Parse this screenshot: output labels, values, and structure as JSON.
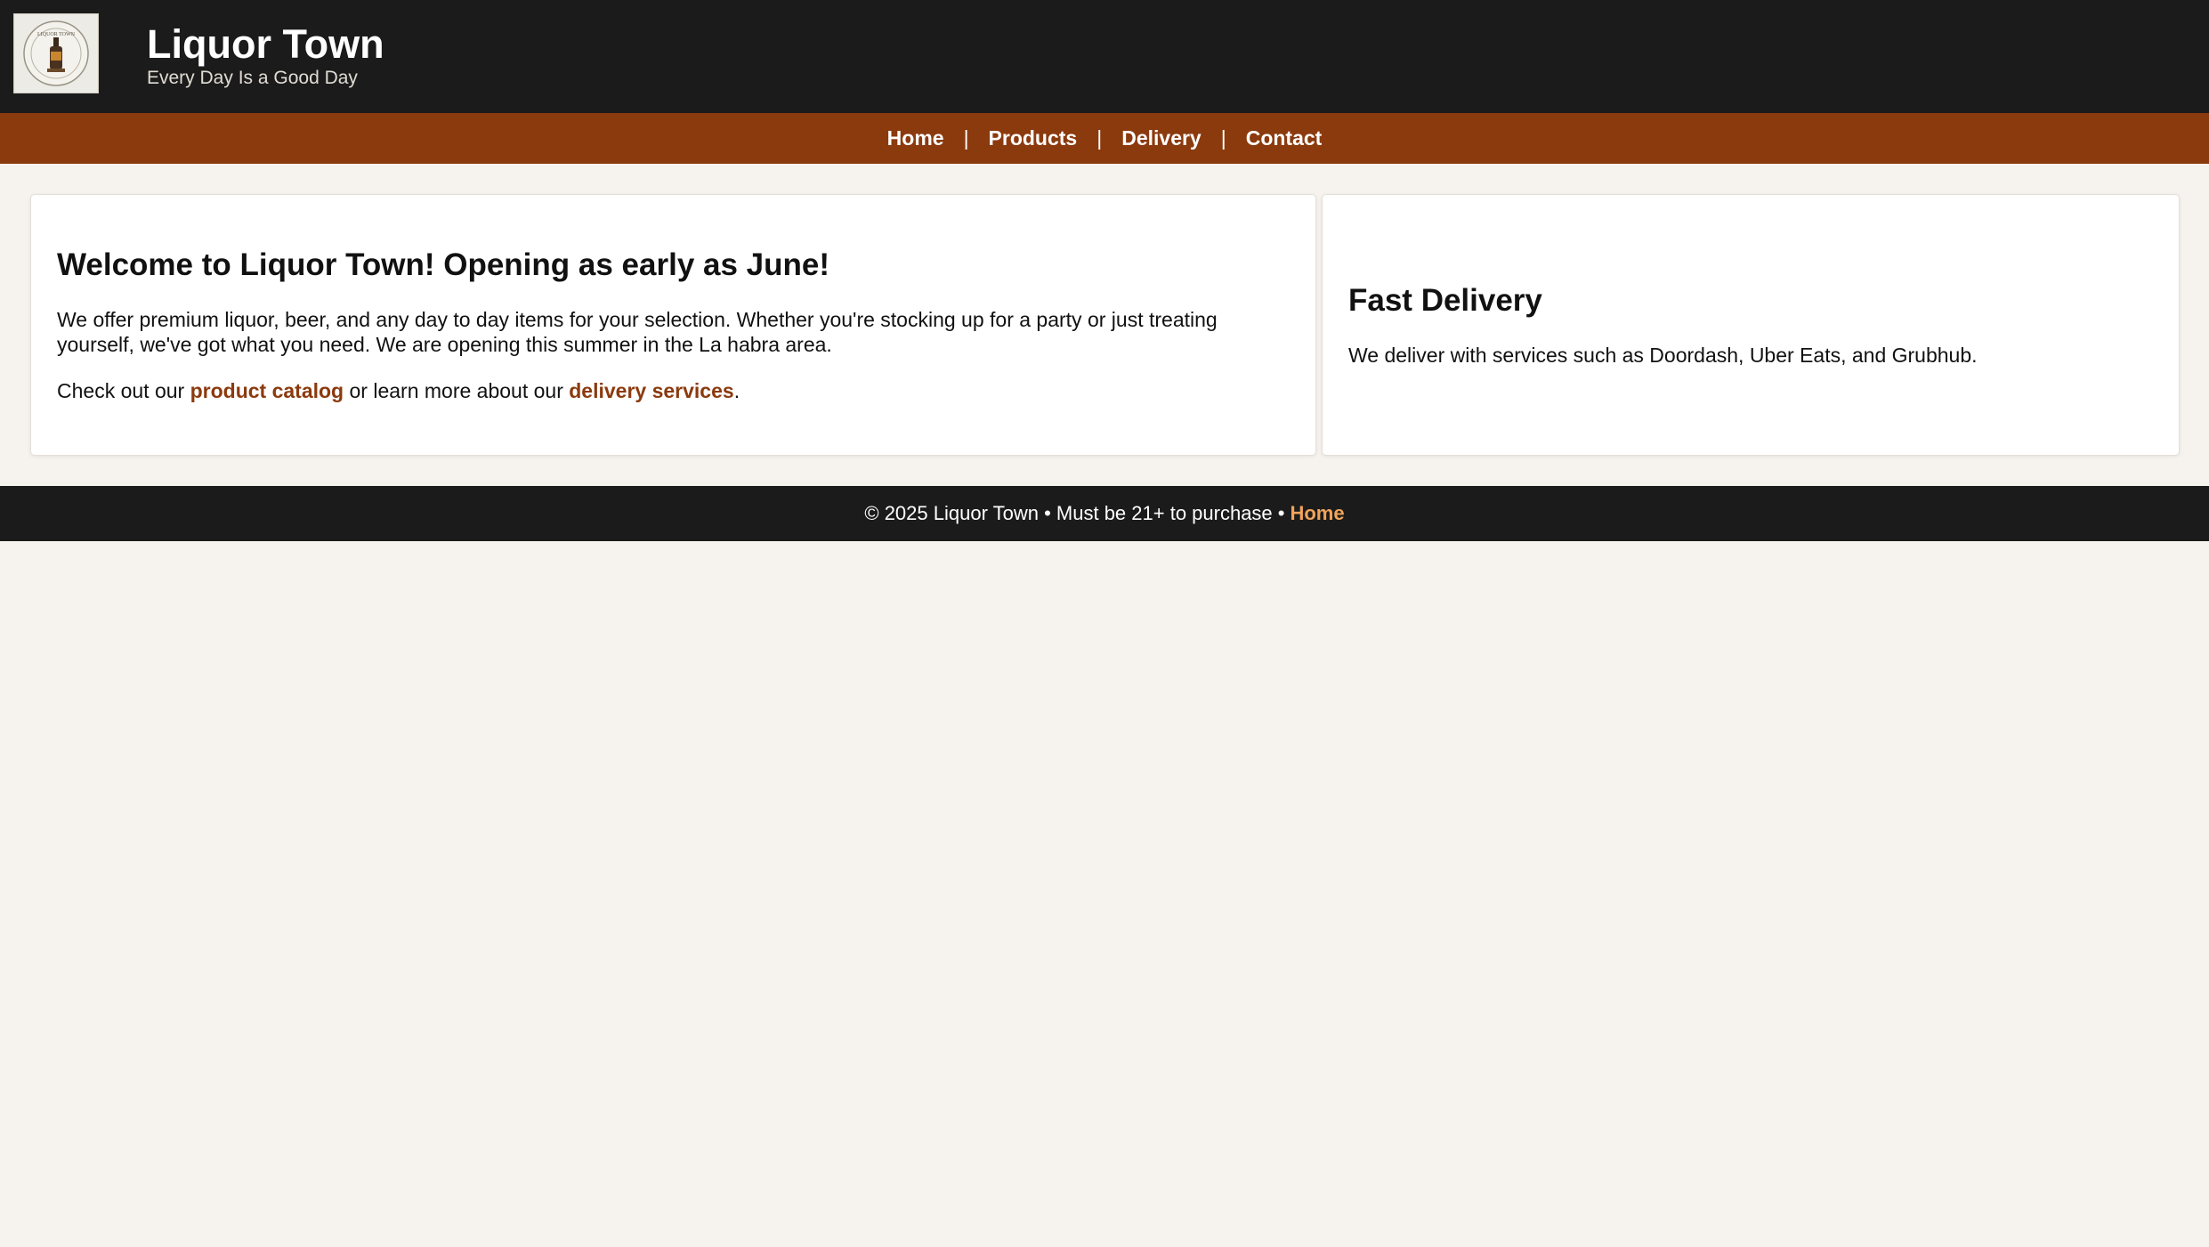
{
  "header": {
    "title": "Liquor Town",
    "tagline": "Every Day Is a Good Day",
    "logo_icon": "liquor-bottle-badge-icon",
    "logo_text": "LIQUOR TOWN"
  },
  "nav": {
    "items": [
      {
        "label": "Home"
      },
      {
        "label": "Products"
      },
      {
        "label": "Delivery"
      },
      {
        "label": "Contact"
      }
    ],
    "separator": "|"
  },
  "welcome": {
    "heading": "Welcome to Liquor Town! Opening as early as June!",
    "paragraph": "We offer premium liquor, beer, and any day to day items for your selection. Whether you're stocking up for a party or just treating yourself, we've got what you need. We are opening this summer in the La habra area.",
    "cta_before": "Check out our",
    "cta_link1": "product catalog",
    "cta_middle": "or learn more about our",
    "cta_link2": "delivery services",
    "cta_end": "."
  },
  "delivery": {
    "heading": "Fast Delivery",
    "paragraph": "We deliver with services such as Doordash, Uber Eats, and Grubhub."
  },
  "footer": {
    "text": "© 2025 Liquor Town • Must be 21+ to purchase •",
    "link": "Home"
  },
  "colors": {
    "header_bg": "#1b1b1b",
    "nav_bg": "#8b3a0e",
    "link": "#8b3a0e",
    "footer_link": "#f0a45a",
    "page_bg": "#f6f3ee"
  }
}
